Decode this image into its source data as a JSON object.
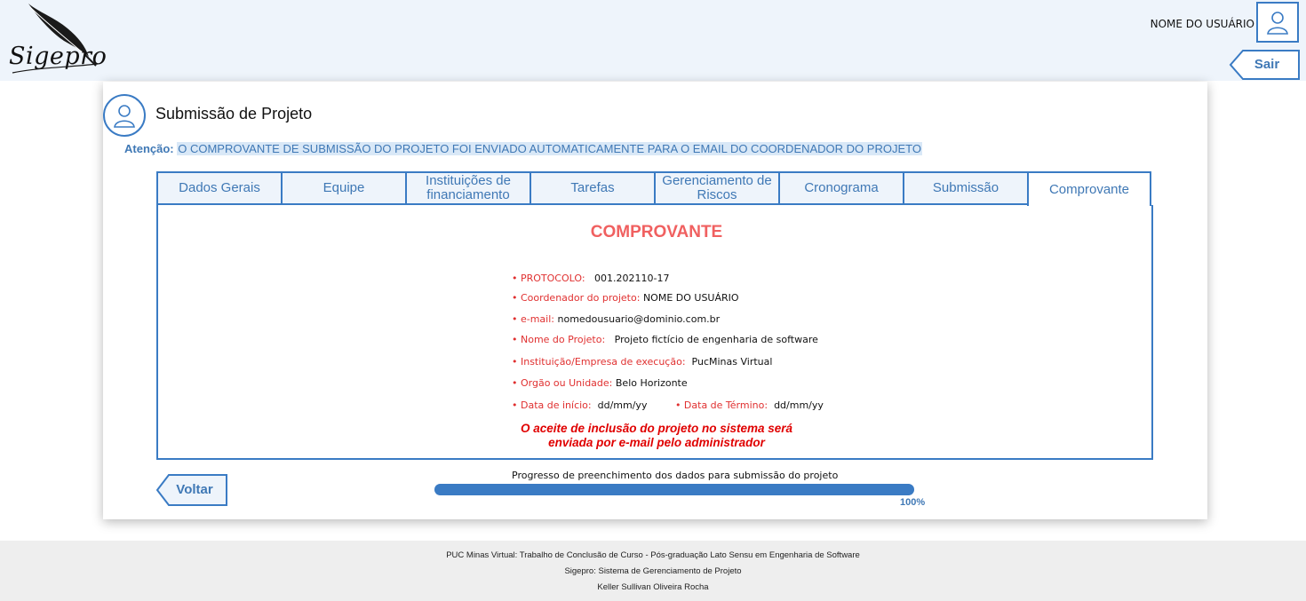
{
  "header": {
    "logo_text": "Sigepro",
    "user_name": "NOME DO USUÁRIO",
    "logout_label": "Sair"
  },
  "page": {
    "title": "Submissão de Projeto",
    "attention_label": "Atenção:",
    "attention_text": "O COMPROVANTE DE SUBMISSÃO DO PROJETO FOI ENVIADO AUTOMATICAMENTE PARA O EMAIL DO COORDENADOR DO PROJETO"
  },
  "tabs": [
    {
      "label": "Dados Gerais"
    },
    {
      "label": "Equipe"
    },
    {
      "label": "Instituições de financiamento"
    },
    {
      "label": "Tarefas"
    },
    {
      "label": "Gerenciamento de Riscos"
    },
    {
      "label": "Cronograma"
    },
    {
      "label": "Submissão"
    },
    {
      "label": "Comprovante",
      "active": true
    }
  ],
  "receipt": {
    "title": "COMPROVANTE",
    "protocol_label": "• PROTOCOLO:",
    "protocol_value": "001.202110-17",
    "coordinator_label": "• Coordenador do projeto:",
    "coordinator_value": "NOME DO USUÁRIO",
    "email_label": "• e-mail:",
    "email_value": "nomedousuario@dominio.com.br",
    "project_label": "• Nome do Projeto:",
    "project_value": "Projeto fictício de engenharia de software",
    "institution_label": "• Instituição/Empresa de execução:",
    "institution_value": "PucMinas Virtual",
    "unit_label": "• Orgão ou Unidade:",
    "unit_value": "Belo Horizonte",
    "start_label": "• Data de início:",
    "start_value": "dd/mm/yy",
    "end_label": "• Data de Término:",
    "end_value": "dd/mm/yy",
    "acceptance_line1": "O aceite de inclusão do projeto no sistema será",
    "acceptance_line2": "enviada por e-mail pelo administrador"
  },
  "progress": {
    "label": "Progresso de preenchimento dos dados para submissão do projeto",
    "percent_text": "100%",
    "value": 1.0
  },
  "actions": {
    "back_label": "Voltar"
  },
  "footer": {
    "line1": "PUC Minas Virtual: Trabalho de Conclusão de Curso - Pós-graduação Lato Sensu em Engenharia de Software",
    "line2": "Sigepro: Sistema de Gerenciamento de Projeto",
    "line3": "Keller Sullivan Oliveira Rocha"
  },
  "colors": {
    "accent": "#3a7bc4",
    "header_bg": "#eef4fb",
    "receipt_title": "#f06060",
    "label_red": "#e03030",
    "warning_red": "#e00000"
  }
}
